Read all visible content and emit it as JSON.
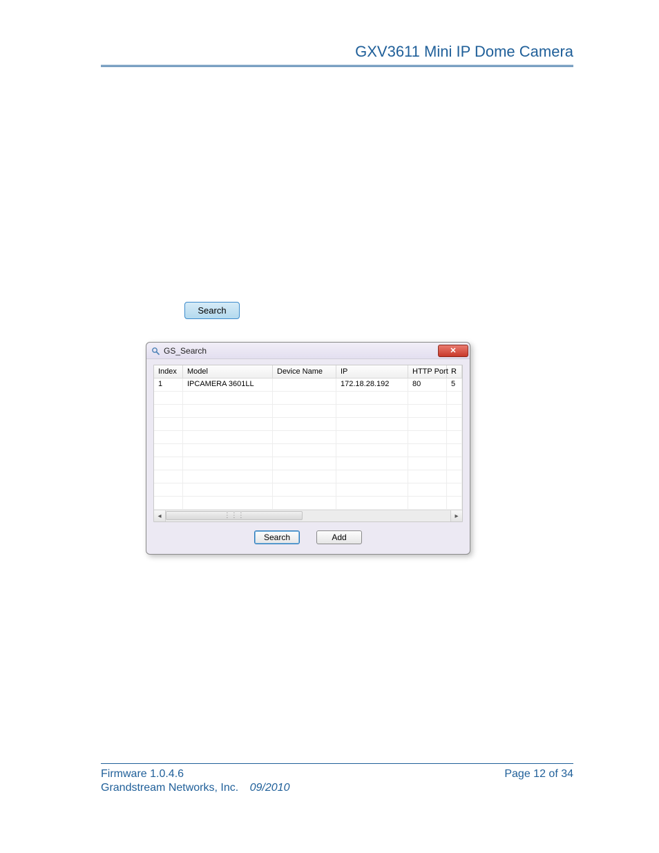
{
  "header": {
    "title": "GXV3611 Mini IP Dome Camera"
  },
  "top_search_button_label": "Search",
  "window": {
    "title": "GS_Search",
    "icon_name": "magnifier-icon",
    "close_label": "✕",
    "columns": {
      "index": "Index",
      "model": "Model",
      "device_name": "Device Name",
      "ip": "IP",
      "http_port": "HTTP Port",
      "extra": "R"
    },
    "rows": [
      {
        "index": "1",
        "model": "IPCAMERA 3601LL",
        "device_name": "",
        "ip": "172.18.28.192",
        "http_port": "80",
        "extra": "5"
      }
    ],
    "scroll": {
      "left_arrow": "◂",
      "right_arrow": "▸",
      "thumb_grip": "⋮⋮⋮"
    },
    "buttons": {
      "search": "Search",
      "add": "Add"
    }
  },
  "footer": {
    "firmware": "Firmware 1.0.4.6",
    "company": "Grandstream Networks, Inc.",
    "date": "09/2010",
    "page_label": "Page 12 of 34"
  }
}
